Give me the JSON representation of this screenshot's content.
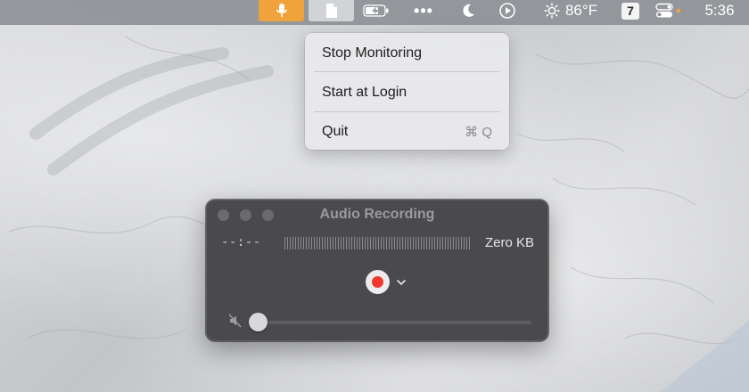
{
  "menubar": {
    "items": [
      {
        "icon": "microphone-icon",
        "accent": "#f0a23c"
      },
      {
        "icon": "document-icon"
      },
      {
        "icon": "battery-charging-icon"
      },
      {
        "icon": "more-dots-icon",
        "label": "•••"
      },
      {
        "icon": "moon-icon"
      },
      {
        "icon": "play-circle-icon"
      }
    ],
    "weather": {
      "icon": "sun-icon",
      "temperature": "86°F"
    },
    "calendar_badge": "7",
    "control_center": {
      "icon": "control-center-icon",
      "indicator_color": "#f0a23c"
    },
    "clock": "5:36"
  },
  "dropdown": {
    "items": [
      {
        "label": "Stop Monitoring",
        "shortcut": ""
      },
      {
        "label": "Start at Login",
        "shortcut": ""
      },
      {
        "label": "Quit",
        "shortcut": "⌘ Q"
      }
    ]
  },
  "recorder": {
    "title": "Audio Recording",
    "elapsed": "--:--",
    "file_size": "Zero KB",
    "record_color": "#f03a2e",
    "volume": 0,
    "muted": true
  }
}
